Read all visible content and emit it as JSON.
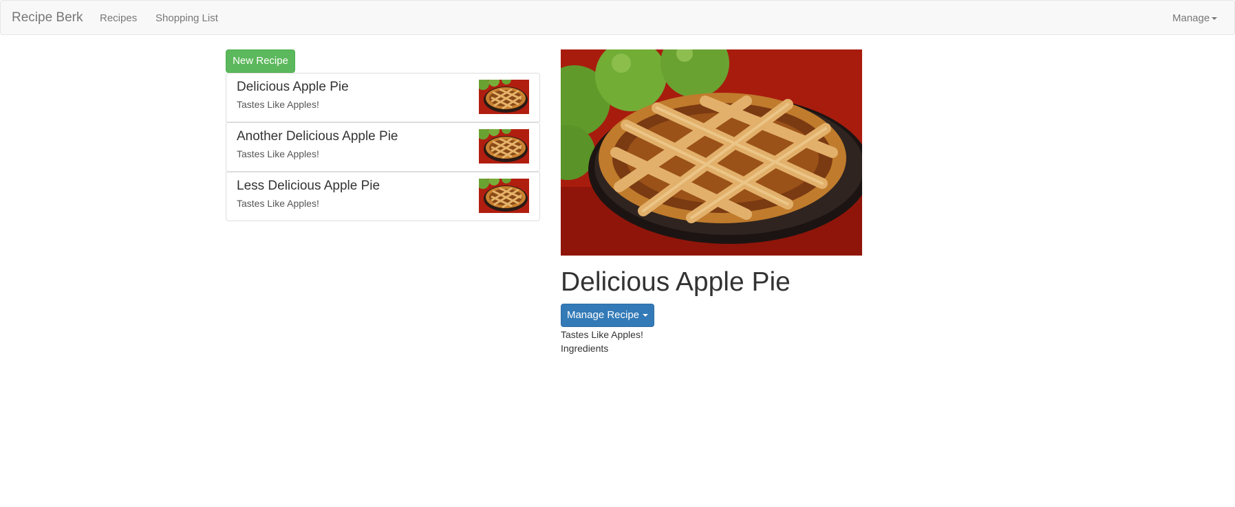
{
  "navbar": {
    "brand": "Recipe Berk",
    "links": [
      {
        "label": "Recipes"
      },
      {
        "label": "Shopping List"
      }
    ],
    "manage_label": "Manage"
  },
  "sidebar": {
    "new_button_label": "New Recipe",
    "recipes": [
      {
        "name": "Delicious Apple Pie",
        "description": "Tastes Like Apples!",
        "image_icon": "apple-pie-thumbnail"
      },
      {
        "name": "Another Delicious Apple Pie",
        "description": "Tastes Like Apples!",
        "image_icon": "apple-pie-thumbnail"
      },
      {
        "name": "Less Delicious Apple Pie",
        "description": "Tastes Like Apples!",
        "image_icon": "apple-pie-thumbnail"
      }
    ]
  },
  "detail": {
    "title": "Delicious Apple Pie",
    "manage_button_label": "Manage Recipe",
    "description": "Tastes Like Apples!",
    "ingredients_label": "Ingredients",
    "image_icon": "apple-pie-photo"
  },
  "colors": {
    "navbar_bg": "#f8f8f8",
    "success_green": "#5cb85c",
    "primary_blue": "#337ab7",
    "link_gray": "#777777"
  }
}
